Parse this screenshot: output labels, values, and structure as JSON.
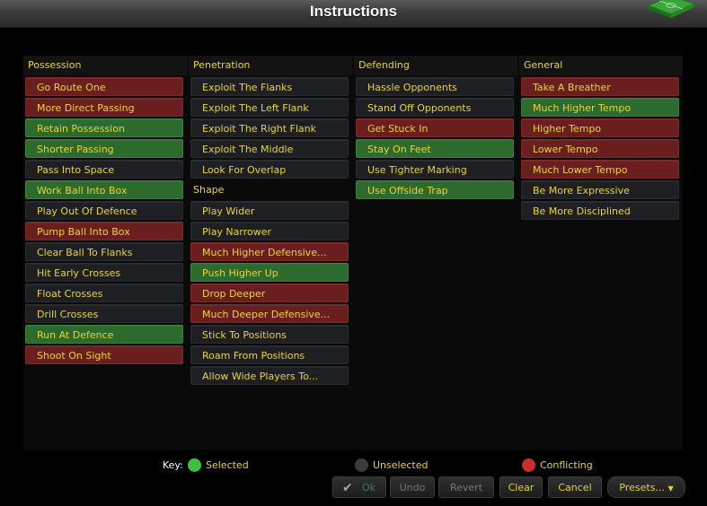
{
  "window": {
    "title": "Instructions"
  },
  "columns": [
    {
      "header": "Possession",
      "items": [
        {
          "label": "Go Route One",
          "state": "conflicting"
        },
        {
          "label": "More Direct Passing",
          "state": "conflicting"
        },
        {
          "label": "Retain Possession",
          "state": "selected"
        },
        {
          "label": "Shorter Passing",
          "state": "selected"
        },
        {
          "label": "Pass Into Space",
          "state": "unselected"
        },
        {
          "label": "Work Ball Into Box",
          "state": "selected"
        },
        {
          "label": "Play Out Of Defence",
          "state": "unselected"
        },
        {
          "label": "Pump Ball Into Box",
          "state": "conflicting"
        },
        {
          "label": "Clear Ball To Flanks",
          "state": "unselected"
        },
        {
          "label": "Hit Early Crosses",
          "state": "unselected"
        },
        {
          "label": "Float Crosses",
          "state": "unselected"
        },
        {
          "label": "Drill Crosses",
          "state": "unselected"
        },
        {
          "label": "Run At Defence",
          "state": "selected"
        },
        {
          "label": "Shoot On Sight",
          "state": "conflicting"
        }
      ]
    },
    {
      "header": "Penetration",
      "items": [
        {
          "label": "Exploit The Flanks",
          "state": "unselected"
        },
        {
          "label": "Exploit The Left Flank",
          "state": "unselected"
        },
        {
          "label": "Exploit The Right Flank",
          "state": "unselected"
        },
        {
          "label": "Exploit The Middle",
          "state": "unselected"
        },
        {
          "label": "Look For Overlap",
          "state": "unselected"
        },
        {
          "label": "Shape",
          "state": "subhdr"
        },
        {
          "label": "Play Wider",
          "state": "unselected"
        },
        {
          "label": "Play Narrower",
          "state": "unselected"
        },
        {
          "label": "Much Higher Defensive...",
          "state": "conflicting"
        },
        {
          "label": "Push Higher Up",
          "state": "selected"
        },
        {
          "label": "Drop Deeper",
          "state": "conflicting"
        },
        {
          "label": "Much Deeper Defensive...",
          "state": "conflicting"
        },
        {
          "label": "Stick To Positions",
          "state": "unselected"
        },
        {
          "label": "Roam From Positions",
          "state": "unselected"
        },
        {
          "label": "Allow Wide Players To...",
          "state": "unselected"
        }
      ]
    },
    {
      "header": "Defending",
      "items": [
        {
          "label": "Hassle Opponents",
          "state": "unselected"
        },
        {
          "label": "Stand Off Opponents",
          "state": "unselected"
        },
        {
          "label": "Get Stuck In",
          "state": "conflicting"
        },
        {
          "label": "Stay On Feet",
          "state": "selected"
        },
        {
          "label": "Use Tighter Marking",
          "state": "unselected"
        },
        {
          "label": "Use Offside Trap",
          "state": "selected"
        }
      ]
    },
    {
      "header": "General",
      "items": [
        {
          "label": "Take A Breather",
          "state": "conflicting"
        },
        {
          "label": "Much Higher Tempo",
          "state": "selected"
        },
        {
          "label": "Higher Tempo",
          "state": "conflicting"
        },
        {
          "label": "Lower Tempo",
          "state": "conflicting"
        },
        {
          "label": "Much Lower Tempo",
          "state": "conflicting"
        },
        {
          "label": "Be More Expressive",
          "state": "unselected"
        },
        {
          "label": "Be More Disciplined",
          "state": "unselected"
        }
      ]
    }
  ],
  "key": {
    "label": "Key:",
    "selected": "Selected",
    "unselected": "Unselected",
    "conflicting": "Conflicting",
    "colors": {
      "selected": "#3fbf3f",
      "unselected": "#3a3c40",
      "conflicting": "#c8302d"
    }
  },
  "buttons": {
    "ok": "Ok",
    "undo": "Undo",
    "revert": "Revert",
    "clear": "Clear",
    "cancel": "Cancel",
    "presets": "Presets..."
  }
}
